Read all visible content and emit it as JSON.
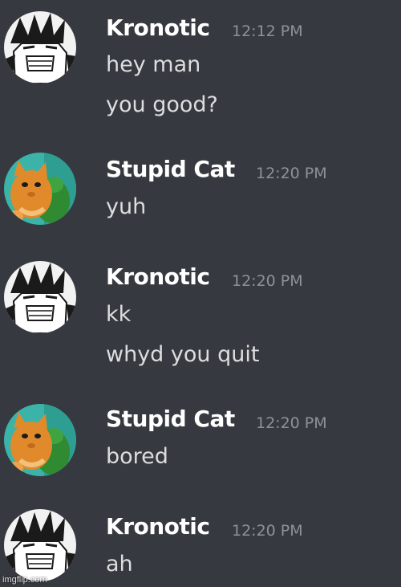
{
  "messages": [
    {
      "author": "Kronotic",
      "avatar_icon": "anime-boy-avatar-icon",
      "time": "12:12 PM",
      "lines": [
        "hey man",
        "you good?"
      ]
    },
    {
      "author": "Stupid Cat",
      "avatar_icon": "cat-avatar-icon",
      "time": "12:20 PM",
      "lines": [
        "yuh"
      ]
    },
    {
      "author": "Kronotic",
      "avatar_icon": "anime-boy-avatar-icon",
      "time": "12:20 PM",
      "lines": [
        "kk",
        "whyd you quit"
      ]
    },
    {
      "author": "Stupid Cat",
      "avatar_icon": "cat-avatar-icon",
      "time": "12:20 PM",
      "lines": [
        "bored"
      ]
    },
    {
      "author": "Kronotic",
      "avatar_icon": "anime-boy-avatar-icon",
      "time": "12:20 PM",
      "lines": [
        "ah"
      ]
    }
  ],
  "watermark": "imgflip.com",
  "colors": {
    "background": "#36393f",
    "username": "#ffffff",
    "timestamp": "#8e9297",
    "message_text": "#dcddde"
  }
}
